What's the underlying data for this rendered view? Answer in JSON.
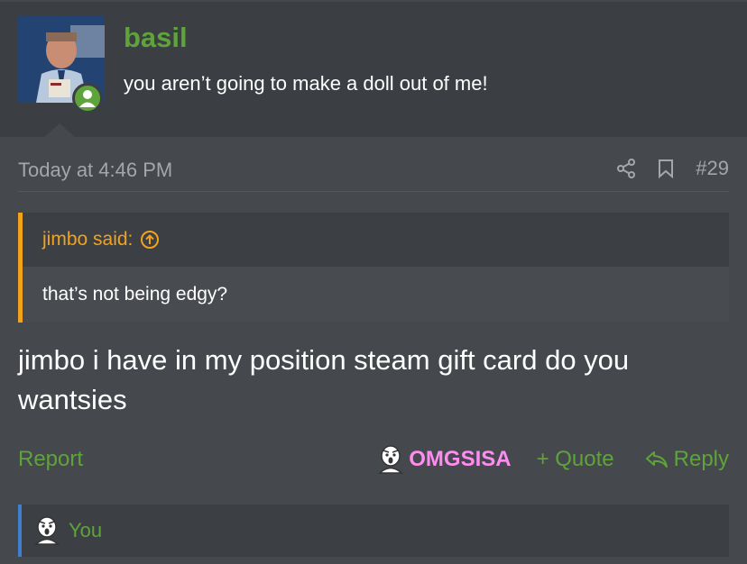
{
  "user": {
    "name": "basil",
    "title": "you aren’t going to make a doll out of me!"
  },
  "post": {
    "time": "Today at 4:46 PM",
    "number": "#29",
    "quote": {
      "author": "jimbo said:",
      "text": "that’s not being edgy?"
    },
    "message": "jimbo i have in my position steam gift card do you wantsies"
  },
  "footer": {
    "report": "Report",
    "reaction_name": "OMGSISA",
    "quote": "+ Quote",
    "reply": "Reply"
  },
  "reactions": {
    "who": "You"
  },
  "colors": {
    "username": "#5fa33b",
    "quote_accent": "#f2a31b",
    "reaction_name": "#ff8cf0",
    "reactions_bar_accent": "#3e7fcf"
  }
}
